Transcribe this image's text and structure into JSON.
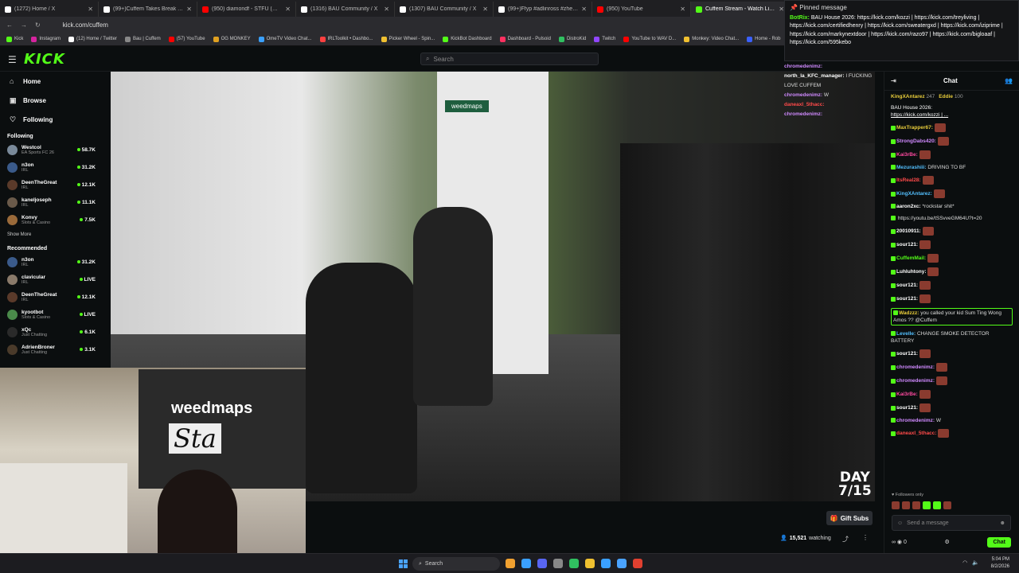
{
  "browser": {
    "tabs": [
      {
        "title": "(1272) Home / X",
        "color": "#ffffff"
      },
      {
        "title": "(99+)Cuffem Takes Break Afte",
        "color": "#ffffff"
      },
      {
        "title": "(950) diamondf - STFU (Officia",
        "color": "#ff0000"
      },
      {
        "title": "(1316) BAU Community / X",
        "color": "#ffffff"
      },
      {
        "title": "(1307) BAU Community / X",
        "color": "#ffffff"
      },
      {
        "title": "(99+)Ffyp #adlinross #zherka",
        "color": "#ffffff"
      },
      {
        "title": "(950) YouTube",
        "color": "#ff0000"
      },
      {
        "title": "Cuffem Stream - Watch Live on",
        "color": "#53fc18"
      }
    ],
    "url": "kick.com/cuffem",
    "bookmarks": [
      {
        "label": "Kick",
        "color": "#53fc18"
      },
      {
        "label": "Instagram",
        "color": "#d6249f"
      },
      {
        "label": "(12) Home / Twitter",
        "color": "#ffffff"
      },
      {
        "label": "Bau | Cuffem",
        "color": "#888888"
      },
      {
        "label": "(57) YouTube",
        "color": "#ff0000"
      },
      {
        "label": "OG MONKEY",
        "color": "#e0a020"
      },
      {
        "label": "OmeTV Video Chat...",
        "color": "#3aa0ff"
      },
      {
        "label": "IRLToolkit • Dashbo...",
        "color": "#ff4040"
      },
      {
        "label": "Picker Wheel - Spin...",
        "color": "#f0c030"
      },
      {
        "label": "KickBot Dashboard",
        "color": "#53fc18"
      },
      {
        "label": "Dashboard - Pulsoid",
        "color": "#ff3060"
      },
      {
        "label": "DistroKid",
        "color": "#30c060"
      },
      {
        "label": "Twitch",
        "color": "#9146ff"
      },
      {
        "label": "YouTube to WAV D...",
        "color": "#ff0000"
      },
      {
        "label": "Monkey: Video Chat...",
        "color": "#f0c030"
      },
      {
        "label": "Home - Rob",
        "color": "#3a60ff"
      }
    ]
  },
  "kick": {
    "logo": "KICK",
    "search_placeholder": "Search",
    "nav": [
      {
        "label": "Home",
        "icon": "home-icon",
        "glyph": "⌂"
      },
      {
        "label": "Browse",
        "icon": "browse-icon",
        "glyph": "▣"
      },
      {
        "label": "Following",
        "icon": "heart-icon",
        "glyph": "♡"
      }
    ],
    "following_title": "Following",
    "following": [
      {
        "name": "Westcol",
        "cat": "EA Sports FC 26",
        "count": "58.7K",
        "color": "#7a8a9a"
      },
      {
        "name": "n3on",
        "cat": "IRL",
        "count": "31.2K",
        "color": "#3a5a8a"
      },
      {
        "name": "DeenTheGreat",
        "cat": "IRL",
        "count": "12.1K",
        "color": "#5a3a2a"
      },
      {
        "name": "kaneljoseph",
        "cat": "IRL",
        "count": "11.1K",
        "color": "#6a5a4a"
      },
      {
        "name": "Konvy",
        "cat": "Slots & Casino",
        "count": "7.5K",
        "color": "#9a6a3a"
      }
    ],
    "show_more": "Show More",
    "recommended_title": "Recommended",
    "recommended": [
      {
        "name": "n3on",
        "cat": "IRL",
        "count": "31.2K",
        "color": "#3a5a8a"
      },
      {
        "name": "clavicular",
        "cat": "IRL",
        "count": "LIVE",
        "color": "#8a7a6a"
      },
      {
        "name": "DeenTheGreat",
        "cat": "IRL",
        "count": "12.1K",
        "color": "#5a3a2a"
      },
      {
        "name": "kyootbot",
        "cat": "Slots & Casino",
        "count": "LIVE",
        "color": "#4a8a4a"
      },
      {
        "name": "xQc",
        "cat": "Just Chatting",
        "count": "6.1K",
        "color": "#2a2a2a"
      },
      {
        "name": "AdrienBroner",
        "cat": "Just Chatting",
        "count": "3.1K",
        "color": "#4a3a2a"
      }
    ]
  },
  "video": {
    "day_line1": "DAY",
    "day_line2": "7/15",
    "wall_sign": "weedmaps",
    "cam_sign": "weedmaps",
    "cam_sign2": "Sta",
    "gift_subs": "Gift Subs",
    "viewers": "15,521",
    "watching_label": "watching"
  },
  "pinned": {
    "header": "Pinned message",
    "user": "BotRix:",
    "text": "BAU House 2026: https://kick.com/kozzi | https://kick.com/treyliving | https://kick.com/certifiedhenry | https://kick.com/sweatergxd | https://kick.com/iziprime | https://kick.com/markynextdoor | https://kick.com/razo97 | https://kick.com/bigloaaf | https://kick.com/595kebo"
  },
  "overlay_chat": [
    {
      "user": "chromedenimz:",
      "text": "",
      "color": "#d08aff"
    },
    {
      "user": "north_la_KFC_manager:",
      "text": "I FUCKING LOVE CUFFEM",
      "color": "#ffffff"
    },
    {
      "user": "chromedenimz:",
      "text": "W",
      "color": "#d08aff"
    },
    {
      "user": "daneaxl_5thacc:",
      "text": "",
      "color": "#ff4a4a"
    },
    {
      "user": "chromedenimz:",
      "text": "",
      "color": "#d08aff"
    }
  ],
  "chat": {
    "title": "Chat",
    "leaders": [
      {
        "user": "KingXAntarez",
        "n": "247"
      },
      {
        "user": "Eddie",
        "n": "100"
      }
    ],
    "pinned_small_title": "BAU House 2026:",
    "pinned_small_link": "https://kick.com/kozzi | ...",
    "messages": [
      {
        "user": "MaxTrapper67:",
        "color": "#e8cc3a",
        "text": ""
      },
      {
        "user": "StrongDabs420:",
        "color": "#d08aff",
        "text": ""
      },
      {
        "user": "Kai3rBe:",
        "color": "#ff4aa0",
        "text": ""
      },
      {
        "user": "Mezurashiii:",
        "color": "#53c0ff",
        "text": "DRIVING TO BF"
      },
      {
        "user": "ItsReal28:",
        "color": "#ff4a4a",
        "text": ""
      },
      {
        "user": "KingXAntarez:",
        "color": "#53c0ff",
        "text": ""
      },
      {
        "user": "aaron2xc:",
        "color": "#ffffff",
        "text": "*rockstar shit*"
      },
      {
        "user": "",
        "color": "#53c0ff",
        "text": "https://youtu.be/tSSvveGM64U?t=20"
      },
      {
        "user": "20010911:",
        "color": "#ffffff",
        "text": ""
      },
      {
        "user": "sour121:",
        "color": "#ffffff",
        "text": ""
      },
      {
        "user": "CuffemMail:",
        "color": "#53fc18",
        "text": ""
      },
      {
        "user": "Luhluhtony:",
        "color": "#ffffff",
        "text": ""
      },
      {
        "user": "sour121:",
        "color": "#ffffff",
        "text": ""
      },
      {
        "user": "sour121:",
        "color": "#ffffff",
        "text": ""
      },
      {
        "user": "Wadzzz:",
        "color": "#e8cc3a",
        "text": "you called your kid Sum Ting Wong Amos ?? @Cuffem",
        "hl": true
      },
      {
        "user": "Levelle:",
        "color": "#53c0ff",
        "text": "CHANGE SMOKE DETECTOR BATTERY"
      },
      {
        "user": "sour121:",
        "color": "#ffffff",
        "text": ""
      },
      {
        "user": "chromedenimz:",
        "color": "#d08aff",
        "text": ""
      },
      {
        "user": "chromedenimz:",
        "color": "#d08aff",
        "text": ""
      },
      {
        "user": "Kai3rBe:",
        "color": "#ff4aa0",
        "text": ""
      },
      {
        "user": "sour121:",
        "color": "#ffffff",
        "text": ""
      },
      {
        "user": "chromedenimz:",
        "color": "#d08aff",
        "text": "W"
      },
      {
        "user": "daneaxl_5thacc:",
        "color": "#ff4a4a",
        "text": ""
      }
    ],
    "followers_only": "Followers only",
    "input_placeholder": "Send a message",
    "points": "0",
    "send_label": "Chat"
  },
  "taskbar": {
    "search_placeholder": "Search",
    "time": "5:04 PM",
    "date": "8/2/2026",
    "apps": [
      "#f0a030",
      "#3aa0ff",
      "#5865f2",
      "#888888",
      "#30c060",
      "#f0c030",
      "#3aa0ff",
      "#4aa3ff",
      "#e04030"
    ]
  }
}
